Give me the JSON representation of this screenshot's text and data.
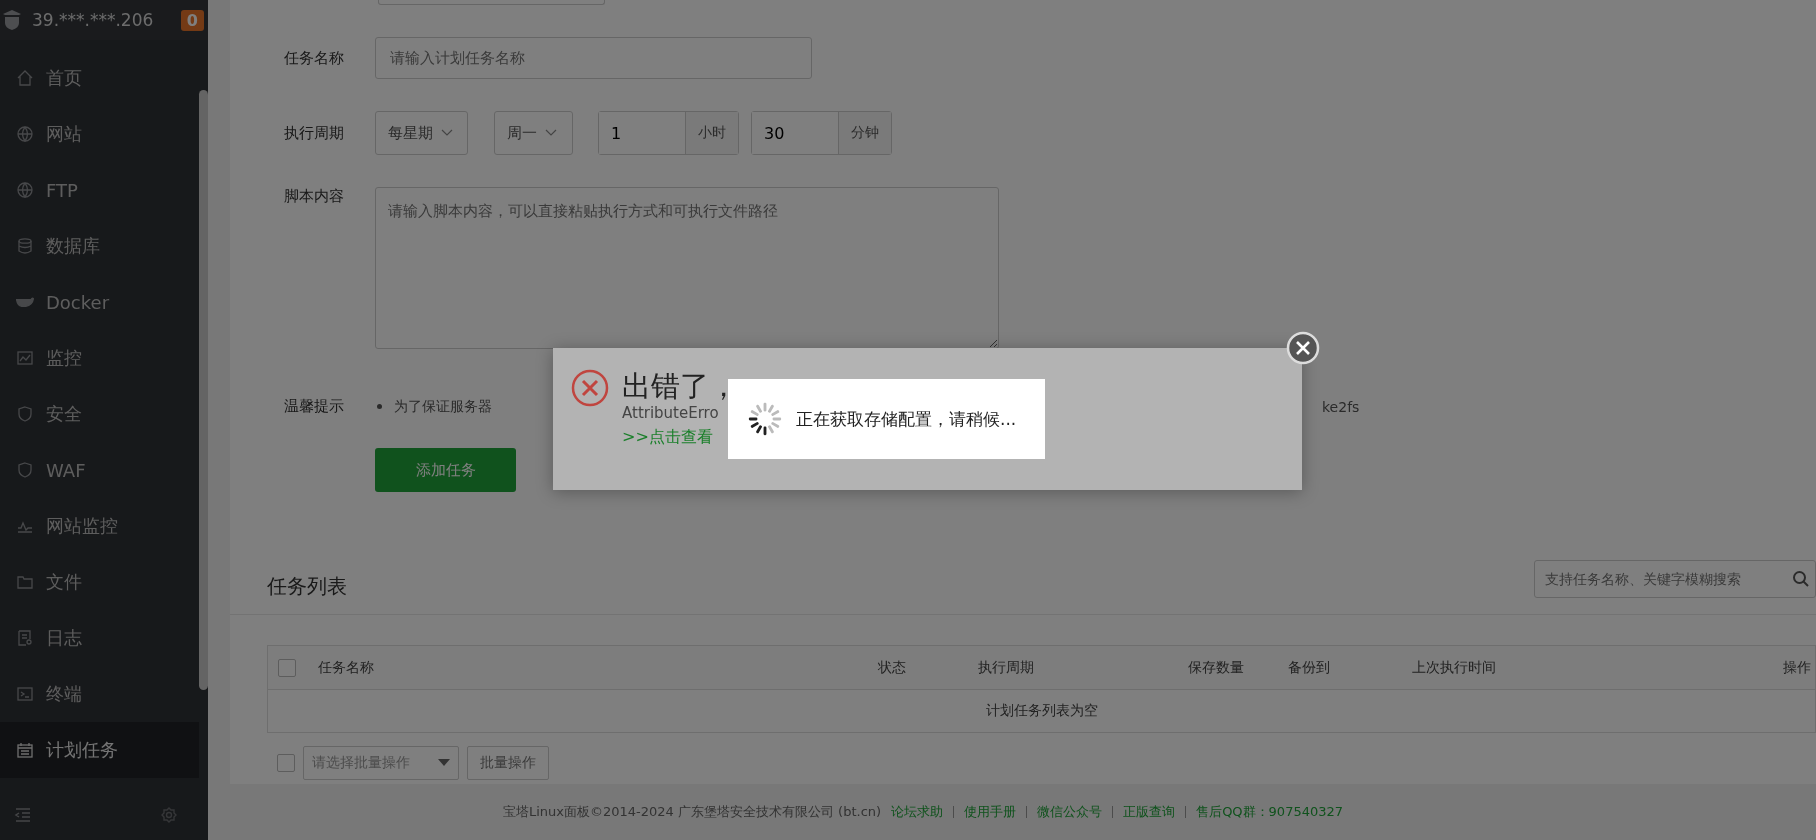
{
  "sidebar": {
    "server": "39.***.***.206",
    "badge": "0",
    "items": [
      {
        "label": "首页",
        "selected": false
      },
      {
        "label": "网站",
        "selected": false
      },
      {
        "label": "FTP",
        "selected": false
      },
      {
        "label": "数据库",
        "selected": false
      },
      {
        "label": "Docker",
        "selected": false
      },
      {
        "label": "监控",
        "selected": false
      },
      {
        "label": "安全",
        "selected": false
      },
      {
        "label": "WAF",
        "selected": false
      },
      {
        "label": "网站监控",
        "selected": false
      },
      {
        "label": "文件",
        "selected": false
      },
      {
        "label": "日志",
        "selected": false
      },
      {
        "label": "终端",
        "selected": false
      },
      {
        "label": "计划任务",
        "selected": true
      }
    ]
  },
  "form": {
    "name_label": "任务名称",
    "name_placeholder": "请输入计划任务名称",
    "cycle_label": "执行周期",
    "cycle_type": "每星期",
    "weekday": "周一",
    "hour": "1",
    "hour_unit": "小时",
    "minute": "30",
    "minute_unit": "分钟",
    "script_label": "脚本内容",
    "script_placeholder": "请输入脚本内容，可以直接粘贴执行方式和可执行文件路径",
    "tip_label": "温馨提示",
    "tip_start": "为了保证服务器",
    "tip_end": "ke2fs",
    "submit": "添加任务"
  },
  "task_list": {
    "title": "任务列表",
    "search_placeholder": "支持任务名称、关键字模糊搜索",
    "select_all_checked": false,
    "batch_checked": false,
    "columns": [
      "任务名称",
      "状态",
      "执行周期",
      "保存数量",
      "备份到",
      "上次执行时间",
      "操作"
    ],
    "empty": "计划任务列表为空",
    "batch_placeholder": "请选择批量操作",
    "batch_button": "批量操作"
  },
  "footer": {
    "copyright": "宝塔Linux面板©2014-2024 广东堡塔安全技术有限公司 (bt.cn)",
    "links": [
      "论坛求助",
      "使用手册",
      "微信公众号",
      "正版查询",
      "售后QQ群：907540327"
    ]
  },
  "error_dialog": {
    "title": "出错了，",
    "detail": "AttributeErro",
    "link": ">>点击查看"
  },
  "loading": {
    "message": "正在获取存储配置，请稍候..."
  }
}
